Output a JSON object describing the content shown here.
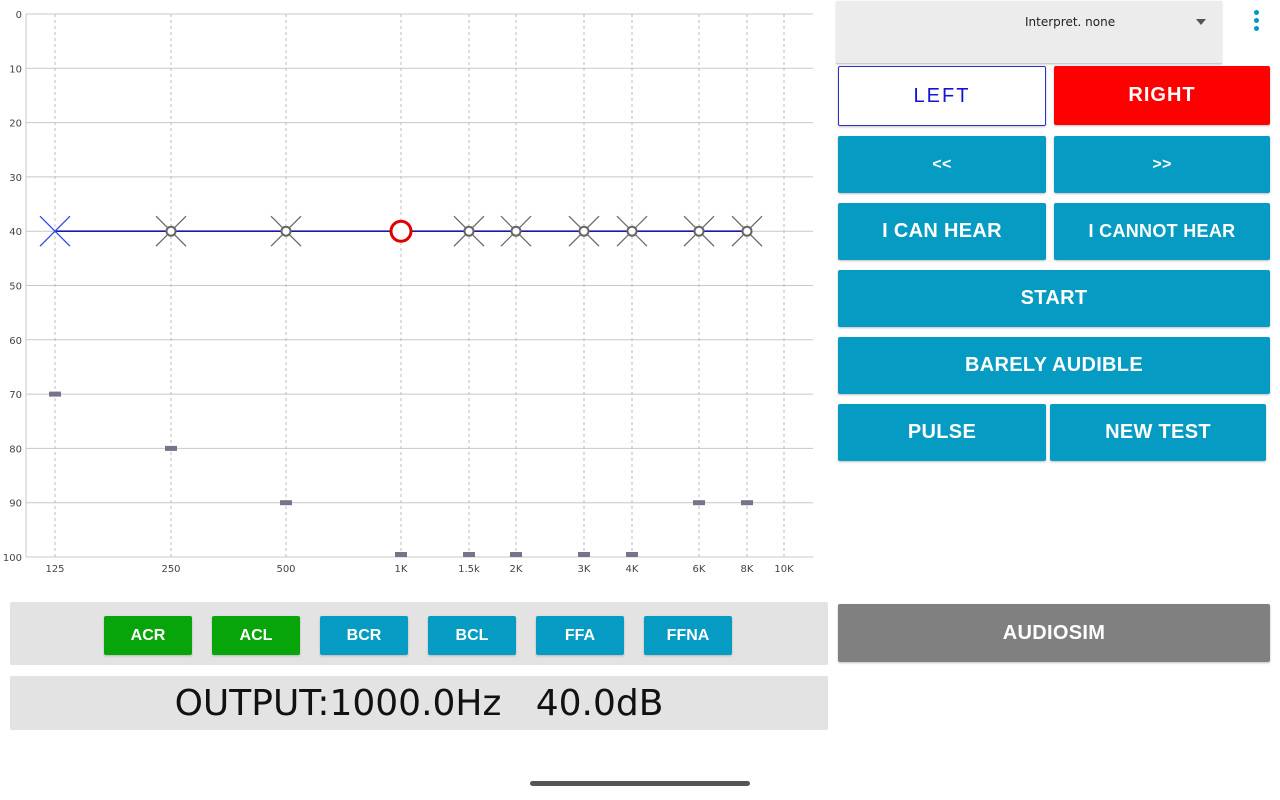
{
  "chart_data": {
    "type": "scatter",
    "title": "",
    "xlabel": "",
    "ylabel": "",
    "ylim": [
      0,
      100
    ],
    "y_inverted": true,
    "y_ticks": [
      "0",
      "10",
      "20",
      "30",
      "40",
      "50",
      "60",
      "70",
      "80",
      "90",
      "100"
    ],
    "x_ticks": [
      "125",
      "250",
      "500",
      "1K",
      "1.5k",
      "2K",
      "3K",
      "4K",
      "6K",
      "8K",
      "10K"
    ],
    "x_scale": "log",
    "series": [
      {
        "values": [
          {
            "x": 125,
            "y": 40,
            "marker": "blue-x"
          },
          {
            "x": 250,
            "y": 40,
            "marker": "gray-x-circle"
          },
          {
            "x": 500,
            "y": 40,
            "marker": "gray-x-circle"
          },
          {
            "x": 1000,
            "y": 40,
            "marker": "red-circle"
          },
          {
            "x": 1500,
            "y": 40,
            "marker": "gray-x-circle"
          },
          {
            "x": 2000,
            "y": 40,
            "marker": "gray-x-circle"
          },
          {
            "x": 3000,
            "y": 40,
            "marker": "gray-x-circle"
          },
          {
            "x": 4000,
            "y": 40,
            "marker": "gray-x-circle"
          },
          {
            "x": 6000,
            "y": 40,
            "marker": "gray-x-circle"
          },
          {
            "x": 8000,
            "y": 40,
            "marker": "gray-x-circle"
          }
        ]
      },
      {
        "values": [
          {
            "x": 125,
            "y": 70
          },
          {
            "x": 250,
            "y": 80
          },
          {
            "x": 500,
            "y": 90
          },
          {
            "x": 1000,
            "y": 100
          },
          {
            "x": 1500,
            "y": 100
          },
          {
            "x": 2000,
            "y": 100
          },
          {
            "x": 3000,
            "y": 100
          },
          {
            "x": 4000,
            "y": 100
          },
          {
            "x": 6000,
            "y": 90
          },
          {
            "x": 8000,
            "y": 90
          }
        ]
      }
    ],
    "colors": {
      "line": "#1a1aaa",
      "gray_marker": "#666666",
      "red_marker": "#e00000",
      "limit_marker": "#74748a"
    }
  },
  "dropdown": {
    "value": "Interpret. none"
  },
  "buttons": {
    "left": "LEFT",
    "right": "RIGHT",
    "prev": "<<",
    "next": ">>",
    "can_hear": "I CAN HEAR",
    "cannot_hear": "I CANNOT HEAR",
    "start": "START",
    "barely_audible": "BARELY AUDIBLE",
    "pulse": "PULSE",
    "new_test": "NEW TEST",
    "audiosim": "AUDIOSIM"
  },
  "test_types": [
    {
      "label": "ACR",
      "color": "#07a50a"
    },
    {
      "label": "ACL",
      "color": "#07a50a"
    },
    {
      "label": "BCR",
      "color": "#069bc3"
    },
    {
      "label": "BCL",
      "color": "#069bc3"
    },
    {
      "label": "FFA",
      "color": "#069bc3"
    },
    {
      "label": "FFNA",
      "color": "#069bc3"
    }
  ],
  "output": {
    "text": "OUTPUT:1000.0Hz   40.0dB"
  }
}
